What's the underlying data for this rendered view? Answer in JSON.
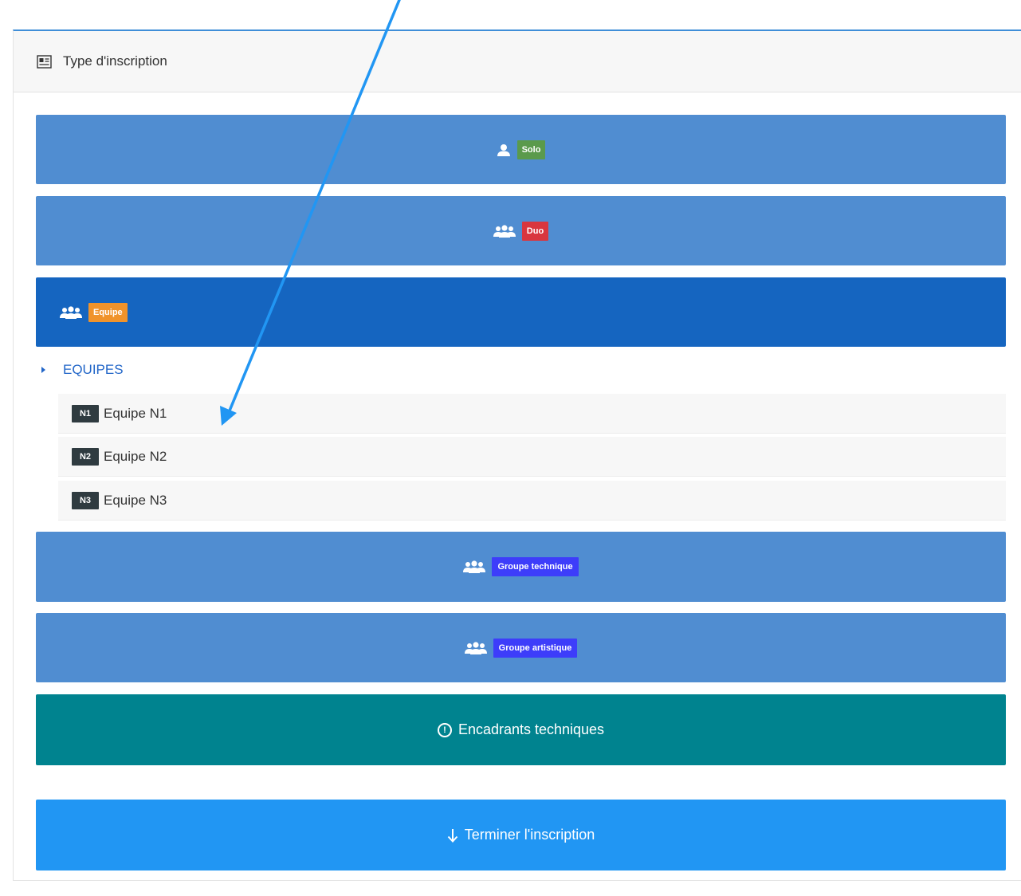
{
  "panel": {
    "title": "Type d'inscription",
    "header_icon": "id-card-icon"
  },
  "options": {
    "solo": {
      "badge": "Solo",
      "icon": "user-icon",
      "badge_color": "#5a9a4c"
    },
    "duo": {
      "badge": "Duo",
      "icon": "users-icon",
      "badge_color": "#d9363e"
    },
    "equipe": {
      "badge": "Equipe",
      "icon": "users-icon",
      "badge_color": "#f0932b"
    },
    "groupe_technique": {
      "badge": "Groupe technique",
      "icon": "users-icon",
      "badge_color": "#3d3dfa"
    },
    "groupe_artistique": {
      "badge": "Groupe artistique",
      "icon": "users-icon",
      "badge_color": "#3d3dfa"
    }
  },
  "equipes": {
    "header": "EQUIPES",
    "items": [
      {
        "level": "N1",
        "label": "Equipe N1"
      },
      {
        "level": "N2",
        "label": "Equipe N2"
      },
      {
        "level": "N3",
        "label": "Equipe N3"
      }
    ]
  },
  "encadrants": {
    "label": "Encadrants techniques",
    "icon": "info-circle-icon"
  },
  "terminer": {
    "label": "Terminer l'inscription",
    "icon": "arrow-down-icon"
  },
  "colors": {
    "accent": "#3f8ed8",
    "option_light": "#508dd1",
    "option_selected": "#1565c0",
    "teal": "#00838f",
    "blue": "#2196f3",
    "annotation_arrow": "#2196f3"
  }
}
